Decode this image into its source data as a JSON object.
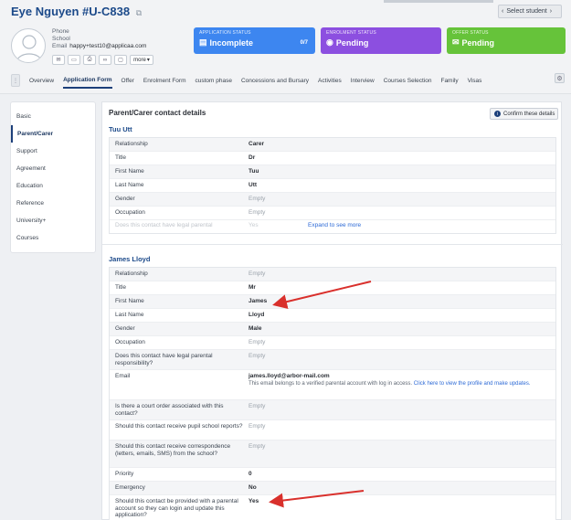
{
  "header": {
    "name": "Eye Nguyen",
    "code": "#U-C838",
    "select_student": "Select student",
    "contact": {
      "phone_label": "Phone",
      "school_label": "School",
      "email_label": "Email",
      "email_value": "happy+test10@applicaa.com"
    },
    "more_label": "more"
  },
  "statuses": [
    {
      "label": "APPLICATION STATUS",
      "value": "Incomplete",
      "count": "0/7",
      "color": "#3d86f0"
    },
    {
      "label": "ENROLMENT STATUS",
      "value": "Pending",
      "color": "#8c4fe0"
    },
    {
      "label": "OFFER STATUS",
      "value": "Pending",
      "color": "#66c33a"
    }
  ],
  "tabs": [
    "Overview",
    "Application Form",
    "Offer",
    "Enrolment Form",
    "custom phase",
    "Concessions and Bursary",
    "Activities",
    "Interview",
    "Courses Selection",
    "Family",
    "Visas"
  ],
  "sidebar": [
    "Basic",
    "Parent/Carer",
    "Support",
    "Agreement",
    "Education",
    "Reference",
    "University+",
    "Courses"
  ],
  "main": {
    "title": "Parent/Carer contact details",
    "confirm_label": "Confirm these details",
    "expand_label": "Expand to see more",
    "contact1": {
      "name": "Tuu Utt",
      "rows": [
        {
          "k": "Relationship",
          "v": "Carer"
        },
        {
          "k": "Title",
          "v": "Dr"
        },
        {
          "k": "First Name",
          "v": "Tuu"
        },
        {
          "k": "Last Name",
          "v": "Utt"
        },
        {
          "k": "Gender",
          "v": "Empty"
        },
        {
          "k": "Occupation",
          "v": "Empty"
        }
      ],
      "faded_key": "Does this contact have legal parental",
      "faded_value": "Yes"
    },
    "contact2": {
      "name": "James Lloyd",
      "rows": [
        {
          "k": "Relationship",
          "v": "Empty"
        },
        {
          "k": "Title",
          "v": "Mr"
        },
        {
          "k": "First Name",
          "v": "James"
        },
        {
          "k": "Last Name",
          "v": "Lloyd"
        },
        {
          "k": "Gender",
          "v": "Male"
        },
        {
          "k": "Occupation",
          "v": "Empty"
        },
        {
          "k": "Does this contact have legal parental responsibility?",
          "v": "Empty"
        },
        {
          "k": "Email",
          "v": "james.lloyd@arbor-mail.com",
          "note": "This email belongs to a verified parental account with log in access.",
          "link": "Click here to view the profile and make updates."
        },
        {
          "k": "Is there a court order associated with this contact?",
          "v": "Empty"
        },
        {
          "k": "Should this contact receive pupil school reports?",
          "v": "Empty"
        },
        {
          "k": "Should this contact receive correspondence (letters, emails, SMS) from the school?",
          "v": "Empty"
        },
        {
          "k": "Priority",
          "v": "0"
        },
        {
          "k": "Emergency",
          "v": "No"
        },
        {
          "k": "Should this contact be provided with a parental account so they can login and update this application?",
          "v": "Yes"
        }
      ]
    }
  },
  "colors": {
    "accent": "#1c3f7a",
    "link": "#2d6ad6",
    "arrow": "#d9302c"
  }
}
